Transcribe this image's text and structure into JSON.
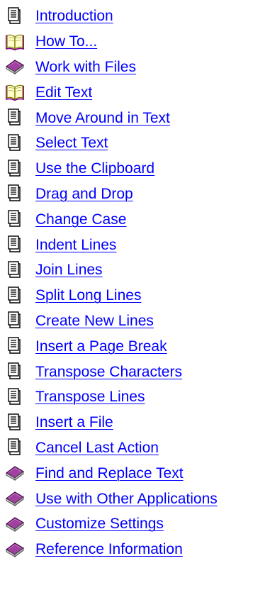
{
  "toc": {
    "link_color": "#0000ff",
    "items": [
      {
        "label": "Introduction",
        "icon": "page-icon"
      },
      {
        "label": "How To...",
        "icon": "open-book-icon"
      },
      {
        "label": "Work with Files",
        "icon": "closed-book-icon"
      },
      {
        "label": "Edit Text",
        "icon": "open-book-icon"
      },
      {
        "label": "Move Around in Text",
        "icon": "page-icon"
      },
      {
        "label": "Select Text",
        "icon": "page-icon"
      },
      {
        "label": "Use the Clipboard",
        "icon": "page-icon"
      },
      {
        "label": "Drag and Drop",
        "icon": "page-icon"
      },
      {
        "label": "Change Case",
        "icon": "page-icon"
      },
      {
        "label": "Indent Lines",
        "icon": "page-icon"
      },
      {
        "label": "Join Lines",
        "icon": "page-icon"
      },
      {
        "label": "Split Long Lines",
        "icon": "page-icon"
      },
      {
        "label": "Create New Lines",
        "icon": "page-icon"
      },
      {
        "label": "Insert a Page Break",
        "icon": "page-icon"
      },
      {
        "label": "Transpose Characters",
        "icon": "page-icon"
      },
      {
        "label": "Transpose Lines",
        "icon": "page-icon"
      },
      {
        "label": "Insert a File",
        "icon": "page-icon"
      },
      {
        "label": "Cancel Last Action",
        "icon": "page-icon"
      },
      {
        "label": "Find and Replace Text",
        "icon": "closed-book-icon"
      },
      {
        "label": "Use with Other Applications",
        "icon": "closed-book-icon"
      },
      {
        "label": "Customize Settings",
        "icon": "closed-book-icon"
      },
      {
        "label": "Reference Information",
        "icon": "closed-book-icon"
      }
    ]
  }
}
